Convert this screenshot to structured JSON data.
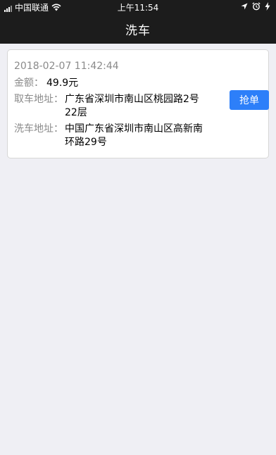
{
  "status_bar": {
    "carrier": "中国联通",
    "time": "上午11:54"
  },
  "nav": {
    "title": "洗车"
  },
  "order": {
    "timestamp": "2018-02-07 11:42:44",
    "amount_label": "金额：",
    "amount_value": "49.9元",
    "pickup_label": "取车地址：",
    "pickup_address": "广东省深圳市南山区桃园路2号22层",
    "wash_label": "洗车地址：",
    "wash_address": "中国广东省深圳市南山区高新南环路29号",
    "grab_button_label": "抢单"
  },
  "colors": {
    "nav_background": "#1c1c1c",
    "page_background": "#efeff4",
    "accent": "#2d7ff9",
    "label_gray": "#8a8a8a"
  },
  "icons": [
    "signal-icon",
    "wifi-icon",
    "location-arrow-icon",
    "alarm-icon",
    "charging-icon"
  ]
}
